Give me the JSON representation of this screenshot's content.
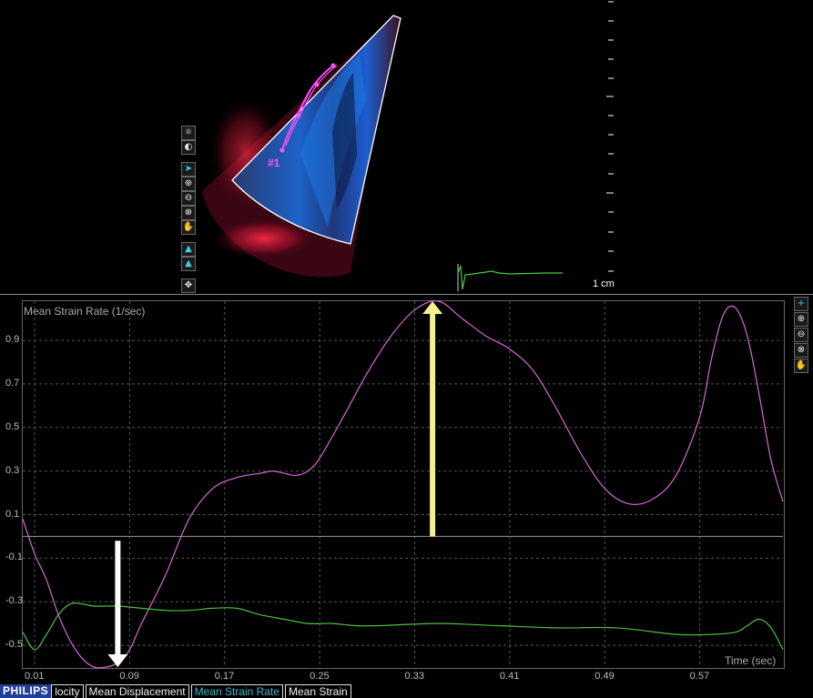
{
  "logo": {
    "text": "PHILIPS"
  },
  "image_panel": {
    "roi_label": "#1",
    "scale_label": "1 cm",
    "tools": [
      {
        "icon": "brightness-icon",
        "glyph": "☼"
      },
      {
        "icon": "contrast-icon",
        "glyph": "◐"
      },
      {
        "icon": "pointer-icon",
        "glyph": "➤"
      },
      {
        "icon": "zoom-in-icon",
        "glyph": "⊕"
      },
      {
        "icon": "zoom-out-icon",
        "glyph": "⊖"
      },
      {
        "icon": "zoom-reset-icon",
        "glyph": "⊗"
      },
      {
        "icon": "pan-hand-icon",
        "glyph": "✋"
      },
      {
        "icon": "sector-icon",
        "glyph": "▲"
      },
      {
        "icon": "sector-fill-icon",
        "glyph": "▲"
      },
      {
        "icon": "settings-icon",
        "glyph": "✥"
      }
    ]
  },
  "graph_tools": [
    {
      "icon": "add-icon",
      "glyph": "+"
    },
    {
      "icon": "zoom-in-icon",
      "glyph": "⊕"
    },
    {
      "icon": "zoom-out-icon",
      "glyph": "⊖"
    },
    {
      "icon": "zoom-reset-icon",
      "glyph": "⊗"
    },
    {
      "icon": "pan-hand-icon",
      "glyph": "✋"
    }
  ],
  "tabs": [
    "locity",
    "Mean Displacement",
    "Mean Strain Rate",
    "Mean Strain"
  ],
  "active_tab": 2,
  "colors": {
    "strain_rate": "#d36ad6",
    "ecg": "#4fbf3f",
    "white_arrow": "#ffffff",
    "yellow_arrow": "#f6f08a",
    "active_tab": "#39b7c9"
  },
  "chart_data": {
    "type": "line",
    "title": "Mean Strain Rate (1/sec)",
    "xlabel": "Time (sec)",
    "ylabel": "",
    "xlim": [
      0.0,
      0.64
    ],
    "ylim": [
      -0.6,
      1.08
    ],
    "grid": true,
    "xticks": [
      "0.01",
      "0.09",
      "0.17",
      "0.25",
      "0.33",
      "0.41",
      "0.49",
      "0.57"
    ],
    "yticks": [
      "0.9",
      "0.7",
      "0.5",
      "0.3",
      "0.1",
      "-0.1",
      "-0.3",
      "-0.5"
    ],
    "series": [
      {
        "key": "strain_rate",
        "x": [
          0.0,
          0.01,
          0.02,
          0.03,
          0.04,
          0.05,
          0.06,
          0.07,
          0.08,
          0.09,
          0.1,
          0.12,
          0.14,
          0.16,
          0.18,
          0.2,
          0.21,
          0.22,
          0.23,
          0.24,
          0.25,
          0.27,
          0.29,
          0.31,
          0.33,
          0.35,
          0.37,
          0.39,
          0.41,
          0.43,
          0.45,
          0.47,
          0.49,
          0.51,
          0.53,
          0.55,
          0.57,
          0.58,
          0.59,
          0.6,
          0.61,
          0.62,
          0.63,
          0.64
        ],
        "y": [
          0.08,
          -0.08,
          -0.2,
          -0.36,
          -0.48,
          -0.56,
          -0.6,
          -0.6,
          -0.58,
          -0.52,
          -0.4,
          -0.18,
          0.08,
          0.22,
          0.27,
          0.29,
          0.3,
          0.29,
          0.28,
          0.3,
          0.36,
          0.55,
          0.75,
          0.92,
          1.04,
          1.08,
          1.0,
          0.92,
          0.86,
          0.76,
          0.58,
          0.38,
          0.22,
          0.15,
          0.17,
          0.28,
          0.55,
          0.82,
          1.02,
          1.05,
          0.92,
          0.65,
          0.35,
          0.16
        ]
      },
      {
        "key": "ecg",
        "x": [
          0.0,
          0.01,
          0.02,
          0.03,
          0.04,
          0.05,
          0.06,
          0.08,
          0.1,
          0.12,
          0.14,
          0.16,
          0.18,
          0.2,
          0.22,
          0.24,
          0.26,
          0.28,
          0.3,
          0.35,
          0.4,
          0.45,
          0.5,
          0.55,
          0.58,
          0.6,
          0.61,
          0.62,
          0.63,
          0.64
        ],
        "y": [
          -0.44,
          -0.52,
          -0.45,
          -0.36,
          -0.31,
          -0.31,
          -0.32,
          -0.32,
          -0.33,
          -0.34,
          -0.34,
          -0.33,
          -0.33,
          -0.36,
          -0.38,
          -0.4,
          -0.4,
          -0.41,
          -0.41,
          -0.4,
          -0.41,
          -0.42,
          -0.42,
          -0.45,
          -0.45,
          -0.44,
          -0.41,
          -0.38,
          -0.42,
          -0.52
        ]
      }
    ],
    "annotations": [
      {
        "type": "arrow",
        "color": "white",
        "x": 0.08,
        "y_from": -0.02,
        "y_to": -0.6
      },
      {
        "type": "arrow",
        "color": "yellow",
        "x": 0.345,
        "y_from": 0.0,
        "y_to": 1.08
      }
    ]
  }
}
